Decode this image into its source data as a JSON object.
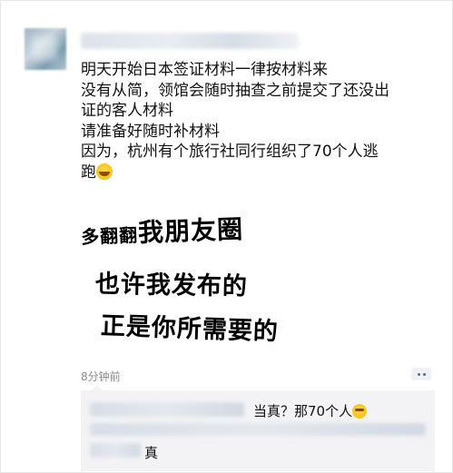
{
  "post": {
    "lines": [
      "明天开始日本签证材料一律按材料来",
      "没有从简，领馆会随时抽查之前提交了还没出",
      "证的客人材料",
      "请准备好随时补材料",
      "因为，杭州有个旅行社同行组织了70个人逃",
      "跑"
    ],
    "emoji": "laughing-face"
  },
  "image": {
    "line1_small": "多翻翻",
    "line1_big": "我朋友圈",
    "line2": "也许我发布的",
    "line3": "正是你所需要的"
  },
  "timestamp": "8分钟前",
  "comments": [
    {
      "text": "当真？那70个人",
      "emoji": "shocked-face"
    },
    {
      "text": "真"
    }
  ],
  "colors": {
    "link_blue": "#576b95",
    "comment_bg": "#f3f3f5",
    "timestamp_gray": "#8a8a8a"
  }
}
